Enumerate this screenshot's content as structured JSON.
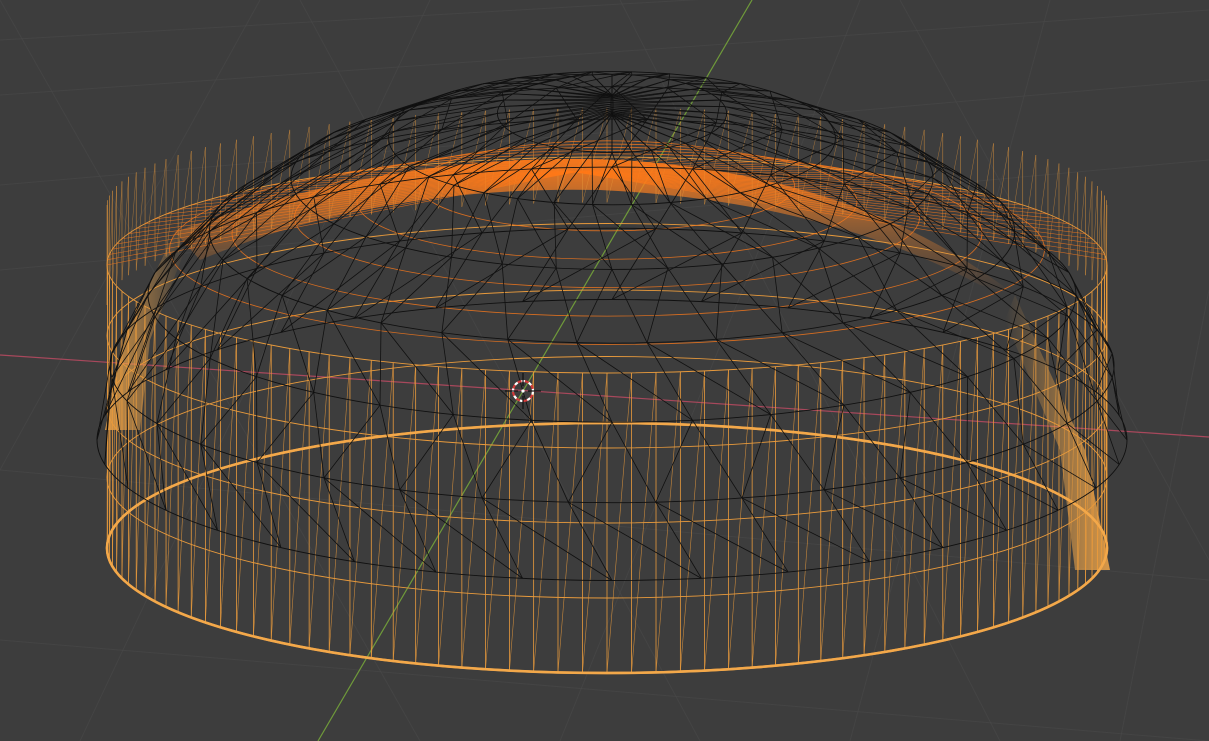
{
  "viewport": {
    "background_color": "#3d3d3d",
    "grid_color": "#4a4a4a",
    "x_axis_color": "#a8485c",
    "y_axis_color": "#6f9a3a",
    "cursor_icon": "3d-cursor-icon"
  },
  "meshes": {
    "selected_object": {
      "shape": "half-dome",
      "wire_color": "#e89a3c",
      "rim_color": "#f3a84a",
      "highlight_color": "#ff7a1a",
      "selected": true
    },
    "unselected_object": {
      "shape": "geodesic-dome",
      "wire_color": "#101010",
      "selected": false
    }
  }
}
